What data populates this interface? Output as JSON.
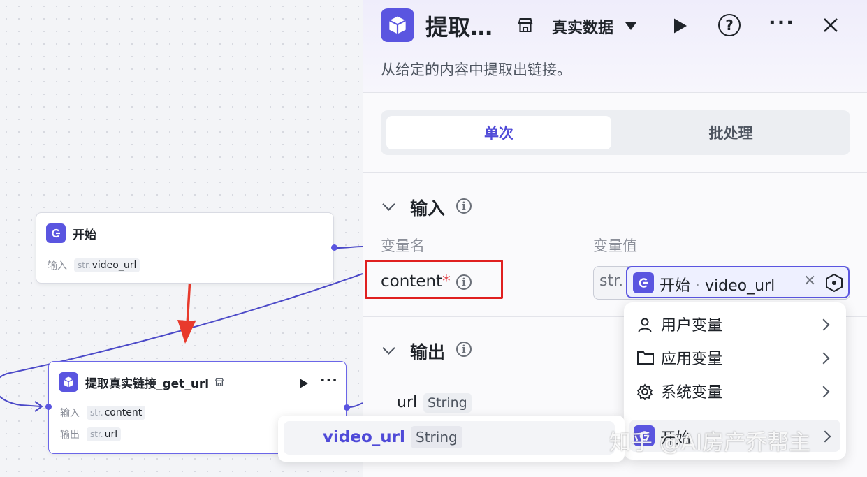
{
  "canvas": {
    "start_node": {
      "title": "开始",
      "input_label": "输入",
      "input_type": "str.",
      "input_var": "video_url"
    },
    "extract_node": {
      "title": "提取真实链接_get_url",
      "input_label": "输入",
      "input_type": "str.",
      "input_var": "content",
      "output_label": "输出",
      "output_type": "str.",
      "output_var": "url"
    }
  },
  "panel": {
    "title": "提取…",
    "environment": "真实数据",
    "description": "从给定的内容中提取出链接。",
    "tabs": [
      "单次",
      "批处理"
    ],
    "input_section": {
      "title": "输入",
      "col_name": "变量名",
      "col_value": "变量值",
      "var_name": "content",
      "required_mark": "*",
      "value_type": "str.",
      "value_source": "开始",
      "value_sep": "·",
      "value_var": "video_url",
      "clear": "×"
    },
    "output_section": {
      "title": "输出",
      "var_name": "url",
      "var_type": "String"
    }
  },
  "dropdown": {
    "items": [
      "用户变量",
      "应用变量",
      "系统变量"
    ],
    "selected_item": "开始"
  },
  "tooltip": {
    "var_name": "video_url",
    "var_type": "String"
  },
  "watermark": "知乎 @AI房产乔帮主",
  "colors": {
    "accent": "#5a55e0",
    "highlight_box": "#e02020",
    "edge": "#4b49c8",
    "arrow": "#e83a2c"
  },
  "icons": [
    "cube-icon",
    "start-icon",
    "store-icon",
    "run-icon",
    "help-icon",
    "more-icon",
    "close-icon",
    "info-icon",
    "user-icon",
    "folder-icon",
    "gear-icon",
    "chevron-right-icon",
    "variable-picker-icon"
  ]
}
